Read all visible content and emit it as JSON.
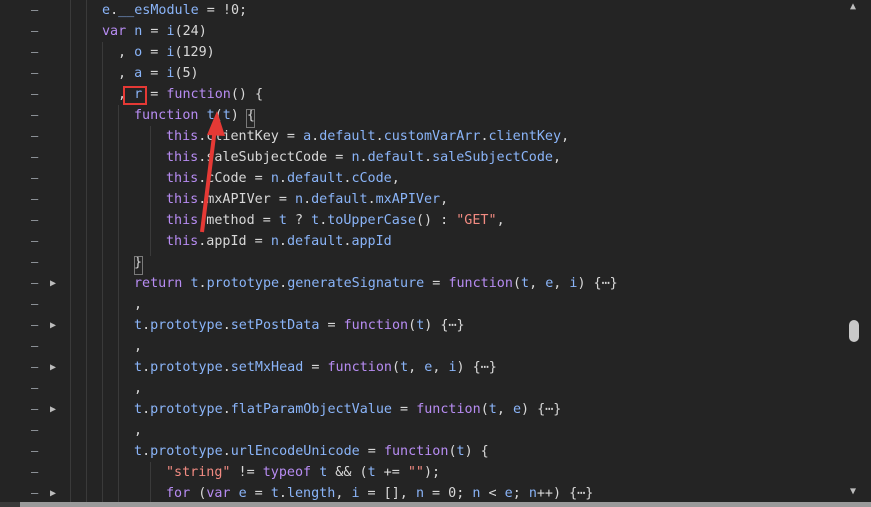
{
  "lines": [
    {
      "gutter": "–",
      "fold": "",
      "indent": 102,
      "tokens": [
        {
          "t": "e",
          "c": "var"
        },
        {
          "t": ".",
          "c": "punct"
        },
        {
          "t": "__esModule",
          "c": "var"
        },
        {
          "t": " = !0;",
          "c": "punct"
        }
      ]
    },
    {
      "gutter": "–",
      "fold": "",
      "indent": 102,
      "tokens": [
        {
          "t": "var",
          "c": "kw"
        },
        {
          "t": " ",
          "c": "punct"
        },
        {
          "t": "n",
          "c": "var"
        },
        {
          "t": " = ",
          "c": "punct"
        },
        {
          "t": "i",
          "c": "var"
        },
        {
          "t": "(24)",
          "c": "punct"
        }
      ]
    },
    {
      "gutter": "–",
      "fold": "",
      "indent": 118,
      "tokens": [
        {
          "t": ", ",
          "c": "punct"
        },
        {
          "t": "o",
          "c": "var"
        },
        {
          "t": " = ",
          "c": "punct"
        },
        {
          "t": "i",
          "c": "var"
        },
        {
          "t": "(129)",
          "c": "punct"
        }
      ]
    },
    {
      "gutter": "–",
      "fold": "",
      "indent": 118,
      "tokens": [
        {
          "t": ", ",
          "c": "punct"
        },
        {
          "t": "a",
          "c": "var"
        },
        {
          "t": " = ",
          "c": "punct"
        },
        {
          "t": "i",
          "c": "var"
        },
        {
          "t": "(5)",
          "c": "punct"
        }
      ]
    },
    {
      "gutter": "–",
      "fold": "",
      "indent": 118,
      "tokens": [
        {
          "t": ", ",
          "c": "punct"
        },
        {
          "t": "r",
          "c": "var"
        },
        {
          "t": " = ",
          "c": "punct"
        },
        {
          "t": "function",
          "c": "kw"
        },
        {
          "t": "() {",
          "c": "punct"
        }
      ]
    },
    {
      "gutter": "–",
      "fold": "",
      "indent": 134,
      "tokens": [
        {
          "t": "function",
          "c": "kw"
        },
        {
          "t": " ",
          "c": "punct"
        },
        {
          "t": "t",
          "c": "var"
        },
        {
          "t": "(",
          "c": "punct"
        },
        {
          "t": "t",
          "c": "var"
        },
        {
          "t": ") {",
          "c": "punct"
        }
      ]
    },
    {
      "gutter": "–",
      "fold": "",
      "indent": 166,
      "tokens": [
        {
          "t": "this",
          "c": "this"
        },
        {
          "t": ".clientKey = ",
          "c": "punct"
        },
        {
          "t": "a",
          "c": "var"
        },
        {
          "t": ".",
          "c": "punct"
        },
        {
          "t": "default",
          "c": "var"
        },
        {
          "t": ".",
          "c": "punct"
        },
        {
          "t": "customVarArr",
          "c": "var"
        },
        {
          "t": ".",
          "c": "punct"
        },
        {
          "t": "clientKey",
          "c": "var"
        },
        {
          "t": ",",
          "c": "punct"
        }
      ]
    },
    {
      "gutter": "–",
      "fold": "",
      "indent": 166,
      "tokens": [
        {
          "t": "this",
          "c": "this"
        },
        {
          "t": ".saleSubjectCode = ",
          "c": "punct"
        },
        {
          "t": "n",
          "c": "var"
        },
        {
          "t": ".",
          "c": "punct"
        },
        {
          "t": "default",
          "c": "var"
        },
        {
          "t": ".",
          "c": "punct"
        },
        {
          "t": "saleSubjectCode",
          "c": "var"
        },
        {
          "t": ",",
          "c": "punct"
        }
      ]
    },
    {
      "gutter": "–",
      "fold": "",
      "indent": 166,
      "tokens": [
        {
          "t": "this",
          "c": "this"
        },
        {
          "t": ".cCode = ",
          "c": "punct"
        },
        {
          "t": "n",
          "c": "var"
        },
        {
          "t": ".",
          "c": "punct"
        },
        {
          "t": "default",
          "c": "var"
        },
        {
          "t": ".",
          "c": "punct"
        },
        {
          "t": "cCode",
          "c": "var"
        },
        {
          "t": ",",
          "c": "punct"
        }
      ]
    },
    {
      "gutter": "–",
      "fold": "",
      "indent": 166,
      "tokens": [
        {
          "t": "this",
          "c": "this"
        },
        {
          "t": ".mxAPIVer = ",
          "c": "punct"
        },
        {
          "t": "n",
          "c": "var"
        },
        {
          "t": ".",
          "c": "punct"
        },
        {
          "t": "default",
          "c": "var"
        },
        {
          "t": ".",
          "c": "punct"
        },
        {
          "t": "mxAPIVer",
          "c": "var"
        },
        {
          "t": ",",
          "c": "punct"
        }
      ]
    },
    {
      "gutter": "–",
      "fold": "",
      "indent": 166,
      "tokens": [
        {
          "t": "this",
          "c": "this"
        },
        {
          "t": ".method = ",
          "c": "punct"
        },
        {
          "t": "t",
          "c": "var"
        },
        {
          "t": " ? ",
          "c": "punct"
        },
        {
          "t": "t",
          "c": "var"
        },
        {
          "t": ".",
          "c": "punct"
        },
        {
          "t": "toUpperCase",
          "c": "var"
        },
        {
          "t": "() : ",
          "c": "punct"
        },
        {
          "t": "\"GET\"",
          "c": "str"
        },
        {
          "t": ",",
          "c": "punct"
        }
      ]
    },
    {
      "gutter": "–",
      "fold": "",
      "indent": 166,
      "tokens": [
        {
          "t": "this",
          "c": "this"
        },
        {
          "t": ".appId = ",
          "c": "punct"
        },
        {
          "t": "n",
          "c": "var"
        },
        {
          "t": ".",
          "c": "punct"
        },
        {
          "t": "default",
          "c": "var"
        },
        {
          "t": ".",
          "c": "punct"
        },
        {
          "t": "appId",
          "c": "var"
        }
      ]
    },
    {
      "gutter": "–",
      "fold": "",
      "indent": 134,
      "tokens": [
        {
          "t": "}",
          "c": "punct"
        }
      ]
    },
    {
      "gutter": "–",
      "fold": "▶",
      "indent": 134,
      "tokens": [
        {
          "t": "return",
          "c": "kw"
        },
        {
          "t": " ",
          "c": "punct"
        },
        {
          "t": "t",
          "c": "var"
        },
        {
          "t": ".",
          "c": "punct"
        },
        {
          "t": "prototype",
          "c": "var"
        },
        {
          "t": ".",
          "c": "punct"
        },
        {
          "t": "generateSignature",
          "c": "var"
        },
        {
          "t": " = ",
          "c": "punct"
        },
        {
          "t": "function",
          "c": "kw"
        },
        {
          "t": "(",
          "c": "punct"
        },
        {
          "t": "t",
          "c": "var"
        },
        {
          "t": ", ",
          "c": "punct"
        },
        {
          "t": "e",
          "c": "var"
        },
        {
          "t": ", ",
          "c": "punct"
        },
        {
          "t": "i",
          "c": "var"
        },
        {
          "t": ") {⋯}",
          "c": "punct"
        }
      ]
    },
    {
      "gutter": "–",
      "fold": "",
      "indent": 134,
      "tokens": [
        {
          "t": ",",
          "c": "punct"
        }
      ]
    },
    {
      "gutter": "–",
      "fold": "▶",
      "indent": 134,
      "tokens": [
        {
          "t": "t",
          "c": "var"
        },
        {
          "t": ".",
          "c": "punct"
        },
        {
          "t": "prototype",
          "c": "var"
        },
        {
          "t": ".",
          "c": "punct"
        },
        {
          "t": "setPostData",
          "c": "var"
        },
        {
          "t": " = ",
          "c": "punct"
        },
        {
          "t": "function",
          "c": "kw"
        },
        {
          "t": "(",
          "c": "punct"
        },
        {
          "t": "t",
          "c": "var"
        },
        {
          "t": ") {⋯}",
          "c": "punct"
        }
      ]
    },
    {
      "gutter": "–",
      "fold": "",
      "indent": 134,
      "tokens": [
        {
          "t": ",",
          "c": "punct"
        }
      ]
    },
    {
      "gutter": "–",
      "fold": "▶",
      "indent": 134,
      "tokens": [
        {
          "t": "t",
          "c": "var"
        },
        {
          "t": ".",
          "c": "punct"
        },
        {
          "t": "prototype",
          "c": "var"
        },
        {
          "t": ".",
          "c": "punct"
        },
        {
          "t": "setMxHead",
          "c": "var"
        },
        {
          "t": " = ",
          "c": "punct"
        },
        {
          "t": "function",
          "c": "kw"
        },
        {
          "t": "(",
          "c": "punct"
        },
        {
          "t": "t",
          "c": "var"
        },
        {
          "t": ", ",
          "c": "punct"
        },
        {
          "t": "e",
          "c": "var"
        },
        {
          "t": ", ",
          "c": "punct"
        },
        {
          "t": "i",
          "c": "var"
        },
        {
          "t": ") {⋯}",
          "c": "punct"
        }
      ]
    },
    {
      "gutter": "–",
      "fold": "",
      "indent": 134,
      "tokens": [
        {
          "t": ",",
          "c": "punct"
        }
      ]
    },
    {
      "gutter": "–",
      "fold": "▶",
      "indent": 134,
      "tokens": [
        {
          "t": "t",
          "c": "var"
        },
        {
          "t": ".",
          "c": "punct"
        },
        {
          "t": "prototype",
          "c": "var"
        },
        {
          "t": ".",
          "c": "punct"
        },
        {
          "t": "flatParamObjectValue",
          "c": "var"
        },
        {
          "t": " = ",
          "c": "punct"
        },
        {
          "t": "function",
          "c": "kw"
        },
        {
          "t": "(",
          "c": "punct"
        },
        {
          "t": "t",
          "c": "var"
        },
        {
          "t": ", ",
          "c": "punct"
        },
        {
          "t": "e",
          "c": "var"
        },
        {
          "t": ") {⋯}",
          "c": "punct"
        }
      ]
    },
    {
      "gutter": "–",
      "fold": "",
      "indent": 134,
      "tokens": [
        {
          "t": ",",
          "c": "punct"
        }
      ]
    },
    {
      "gutter": "–",
      "fold": "",
      "indent": 134,
      "tokens": [
        {
          "t": "t",
          "c": "var"
        },
        {
          "t": ".",
          "c": "punct"
        },
        {
          "t": "prototype",
          "c": "var"
        },
        {
          "t": ".",
          "c": "punct"
        },
        {
          "t": "urlEncodeUnicode",
          "c": "var"
        },
        {
          "t": " = ",
          "c": "punct"
        },
        {
          "t": "function",
          "c": "kw"
        },
        {
          "t": "(",
          "c": "punct"
        },
        {
          "t": "t",
          "c": "var"
        },
        {
          "t": ") {",
          "c": "punct"
        }
      ]
    },
    {
      "gutter": "–",
      "fold": "",
      "indent": 166,
      "tokens": [
        {
          "t": "\"string\"",
          "c": "str"
        },
        {
          "t": " != ",
          "c": "punct"
        },
        {
          "t": "typeof",
          "c": "kw"
        },
        {
          "t": " ",
          "c": "punct"
        },
        {
          "t": "t",
          "c": "var"
        },
        {
          "t": " && (",
          "c": "punct"
        },
        {
          "t": "t",
          "c": "var"
        },
        {
          "t": " += ",
          "c": "punct"
        },
        {
          "t": "\"\"",
          "c": "str"
        },
        {
          "t": ");",
          "c": "punct"
        }
      ]
    },
    {
      "gutter": "–",
      "fold": "▶",
      "indent": 166,
      "tokens": [
        {
          "t": "for",
          "c": "kw"
        },
        {
          "t": " (",
          "c": "punct"
        },
        {
          "t": "var",
          "c": "kw"
        },
        {
          "t": " ",
          "c": "punct"
        },
        {
          "t": "e",
          "c": "var"
        },
        {
          "t": " = ",
          "c": "punct"
        },
        {
          "t": "t",
          "c": "var"
        },
        {
          "t": ".",
          "c": "punct"
        },
        {
          "t": "length",
          "c": "var"
        },
        {
          "t": ", ",
          "c": "punct"
        },
        {
          "t": "i",
          "c": "var"
        },
        {
          "t": " = [], ",
          "c": "punct"
        },
        {
          "t": "n",
          "c": "var"
        },
        {
          "t": " = 0; ",
          "c": "punct"
        },
        {
          "t": "n",
          "c": "var"
        },
        {
          "t": " < ",
          "c": "punct"
        },
        {
          "t": "e",
          "c": "var"
        },
        {
          "t": "; ",
          "c": "punct"
        },
        {
          "t": "n",
          "c": "var"
        },
        {
          "t": "++) {⋯}",
          "c": "punct"
        }
      ]
    }
  ],
  "icons": {
    "scroll_up": "▲",
    "scroll_down": "▼"
  },
  "colors": {
    "background": "#242424",
    "keyword": "#b78cf2",
    "variable": "#8ab4f8",
    "string": "#f28b82",
    "annotation": "#e53935"
  }
}
